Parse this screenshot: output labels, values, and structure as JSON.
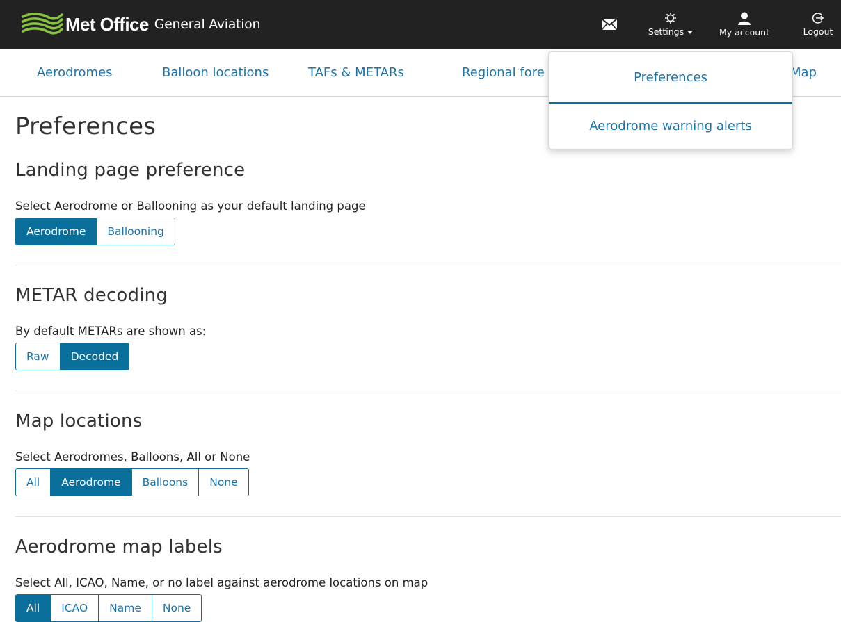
{
  "header": {
    "brand_name": "Met Office",
    "brand_sub": "General Aviation",
    "actions": {
      "mail_icon": "envelope-icon",
      "settings_label": "Settings",
      "account_label": "My account",
      "logout_label": "Logout"
    }
  },
  "nav": {
    "items": [
      "Aerodromes",
      "Balloon locations",
      "TAFs & METARs",
      "Regional fore",
      "Map"
    ]
  },
  "dropdown": {
    "items": [
      "Preferences",
      "Aerodrome warning alerts"
    ]
  },
  "page": {
    "title": "Preferences"
  },
  "sections": {
    "landing": {
      "title": "Landing page preference",
      "desc": "Select Aerodrome or Ballooning as your default landing page",
      "options": [
        "Aerodrome",
        "Ballooning"
      ],
      "selected": "Aerodrome"
    },
    "metar": {
      "title": "METAR decoding",
      "desc": "By default METARs are shown as:",
      "options": [
        "Raw",
        "Decoded"
      ],
      "selected": "Decoded"
    },
    "map_locations": {
      "title": "Map locations",
      "desc": "Select Aerodromes, Balloons, All or None",
      "options": [
        "All",
        "Aerodrome",
        "Balloons",
        "None"
      ],
      "selected": "Aerodrome"
    },
    "map_labels": {
      "title": "Aerodrome map labels",
      "desc": "Select All, ICAO, Name, or no label against aerodrome locations on map",
      "options": [
        "All",
        "ICAO",
        "Name",
        "None"
      ],
      "selected": "All"
    }
  },
  "colors": {
    "header_bg": "#222222",
    "accent": "#0a6e9b",
    "link": "#1c73a8",
    "logo_green": "#86c440"
  }
}
